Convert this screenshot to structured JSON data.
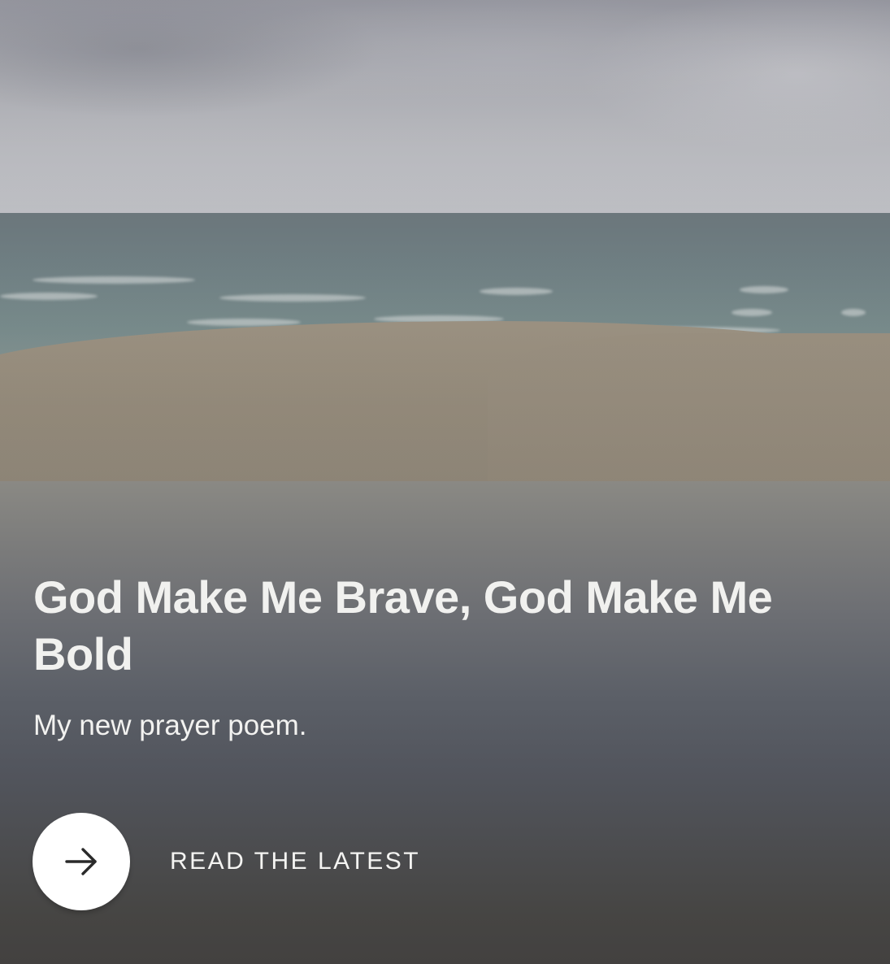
{
  "hero": {
    "image_description_icon": "beach-photo"
  },
  "post": {
    "title": "God Make Me Brave, God Make Me Bold",
    "subtitle": "My new prayer poem."
  },
  "cta": {
    "icon": "arrow-right-icon",
    "label": "READ THE LATEST"
  },
  "colors": {
    "button_background": "#ffffff",
    "arrow": "#2a2a2a",
    "text": "#f2f2f0"
  }
}
